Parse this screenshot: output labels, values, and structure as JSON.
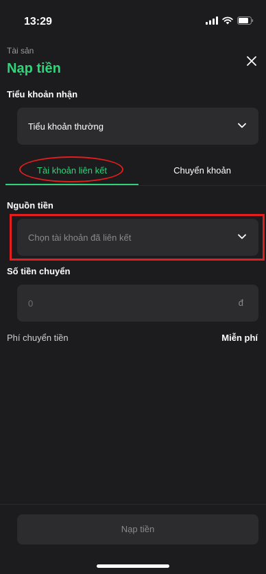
{
  "status_bar": {
    "time": "13:29"
  },
  "header": {
    "breadcrumb": "Tài sản",
    "title": "Nạp tiền",
    "accent_color": "#2fd47a"
  },
  "receiving_account": {
    "label": "Tiểu khoản nhận",
    "selected_value": "Tiểu khoản thường"
  },
  "tabs": [
    {
      "label": "Tài khoản liên kết",
      "active": true
    },
    {
      "label": "Chuyển khoản",
      "active": false
    }
  ],
  "source": {
    "label": "Nguồn tiền",
    "placeholder": "Chọn tài khoản đã liên kết"
  },
  "amount": {
    "label": "Số tiền chuyển",
    "placeholder": "0",
    "unit": "đ"
  },
  "fee": {
    "label": "Phí chuyển tiền",
    "value": "Miễn phí"
  },
  "submit": {
    "label": "Nạp tiền"
  },
  "annotation_color": "#e51d1d"
}
